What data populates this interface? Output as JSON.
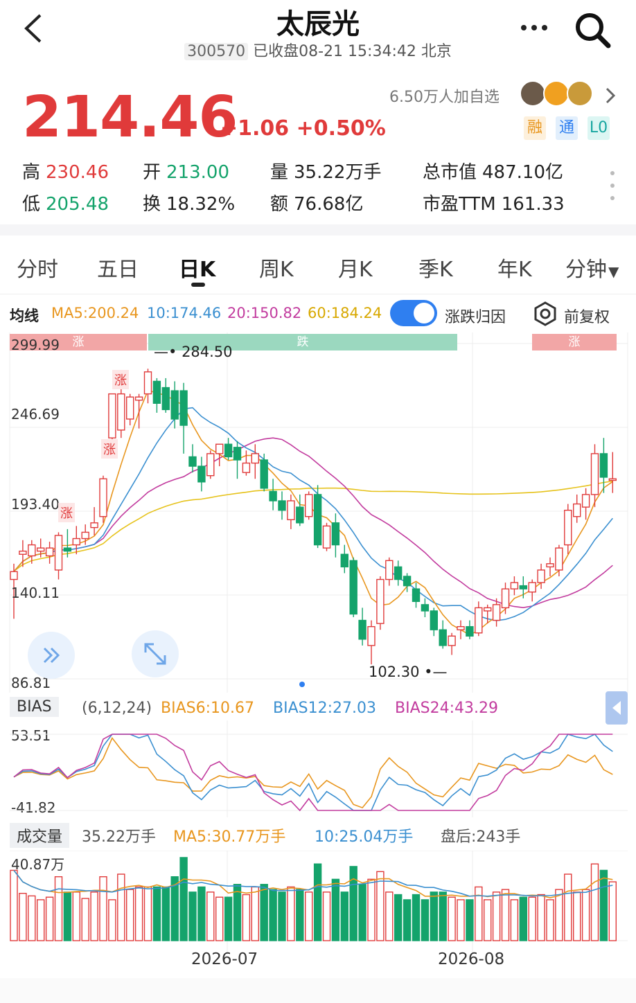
{
  "header": {
    "title": "太辰光",
    "code": "300570",
    "status": "已收盘08-21 15:34:42 北京"
  },
  "quote": {
    "price": "214.46",
    "change": "+1.06 +0.50%",
    "watch_count": "6.50万人加自选",
    "tags": [
      "融",
      "通",
      "L0"
    ]
  },
  "stats": {
    "high_label": "高",
    "high": "230.46",
    "low_label": "低",
    "low": "205.48",
    "open_label": "开",
    "open": "213.00",
    "turnover_label": "换",
    "turnover": "18.32%",
    "volume_label": "量",
    "volume": "35.22万手",
    "amount_label": "额",
    "amount": "76.68亿",
    "mktcap_label": "总市值",
    "mktcap": "487.10亿",
    "pe_label": "市盈TTM",
    "pe": "161.33"
  },
  "period_tabs": [
    "分时",
    "五日",
    "日K",
    "周K",
    "月K",
    "季K",
    "年K",
    "分钟"
  ],
  "active_tab": "日K",
  "ma_legend": {
    "label": "均线",
    "ma5": "MA5:200.24",
    "ma10": "10:174.46",
    "ma20": "20:150.82",
    "ma60": "60:184.24",
    "toggle_label": "涨跌归因",
    "adjust_label": "前复权"
  },
  "colors": {
    "up": "#e03a3a",
    "down": "#14a36b",
    "ma5": "#e8961e",
    "ma10": "#3a8fd0",
    "ma20": "#c23b9e",
    "ma60": "#e6c21a",
    "accent": "#2f7ff0"
  },
  "chart_data": [
    {
      "type": "candlestick",
      "y_ticks": [
        "299.99",
        "246.69",
        "193.40",
        "140.11",
        "86.81"
      ],
      "ylim": [
        86.81,
        299.99
      ],
      "x_ticks": [
        "2026-07",
        "2026-08"
      ],
      "max_label": "284.50",
      "min_label": "102.30",
      "attribution_bands": [
        "涨",
        "跌",
        "涨"
      ],
      "up_markers": [
        "涨",
        "涨",
        "涨"
      ],
      "candles": [
        [
          150,
          160,
          125,
          155
        ],
        [
          166,
          175,
          158,
          168
        ],
        [
          165,
          175,
          160,
          172
        ],
        [
          168,
          176,
          164,
          170
        ],
        [
          165,
          174,
          160,
          170
        ],
        [
          156,
          180,
          150,
          178
        ],
        [
          170,
          182,
          164,
          168
        ],
        [
          172,
          184,
          166,
          176
        ],
        [
          176,
          185,
          172,
          180
        ],
        [
          183,
          196,
          178,
          186
        ],
        [
          190,
          216,
          186,
          214
        ],
        [
          240,
          248,
          236,
          268
        ],
        [
          245,
          272,
          240,
          268
        ],
        [
          252,
          268,
          248,
          266
        ],
        [
          264,
          268,
          246,
          266
        ],
        [
          268,
          284,
          262,
          282
        ],
        [
          276,
          278,
          256,
          262
        ],
        [
          272,
          278,
          256,
          258
        ],
        [
          270,
          276,
          246,
          252
        ],
        [
          270,
          275,
          230,
          248
        ],
        [
          228,
          236,
          218,
          222
        ],
        [
          222,
          228,
          206,
          212
        ],
        [
          216,
          232,
          214,
          230
        ],
        [
          230,
          236,
          222,
          236
        ],
        [
          236,
          240,
          226,
          228
        ],
        [
          234,
          238,
          214,
          226
        ],
        [
          218,
          232,
          216,
          224
        ],
        [
          224,
          236,
          214,
          230
        ],
        [
          226,
          230,
          206,
          208
        ],
        [
          206,
          214,
          194,
          200
        ],
        [
          200,
          206,
          188,
          194
        ],
        [
          188,
          204,
          182,
          200
        ],
        [
          196,
          204,
          184,
          186
        ],
        [
          190,
          206,
          188,
          204
        ],
        [
          204,
          210,
          170,
          172
        ],
        [
          170,
          186,
          168,
          184
        ],
        [
          186,
          192,
          164,
          172
        ],
        [
          166,
          172,
          154,
          158
        ],
        [
          162,
          164,
          126,
          128
        ],
        [
          124,
          132,
          108,
          112
        ],
        [
          108,
          124,
          96,
          120
        ],
        [
          122,
          152,
          118,
          150
        ],
        [
          150,
          164,
          146,
          162
        ],
        [
          158,
          162,
          146,
          150
        ],
        [
          152,
          154,
          142,
          146
        ],
        [
          144,
          148,
          132,
          136
        ],
        [
          134,
          138,
          126,
          130
        ],
        [
          130,
          132,
          114,
          118
        ],
        [
          118,
          124,
          106,
          108
        ],
        [
          108,
          116,
          102,
          114
        ],
        [
          118,
          124,
          112,
          120
        ],
        [
          120,
          124,
          112,
          114
        ],
        [
          116,
          136,
          114,
          132
        ],
        [
          130,
          134,
          122,
          132
        ],
        [
          124,
          138,
          120,
          134
        ],
        [
          132,
          148,
          128,
          144
        ],
        [
          144,
          152,
          140,
          148
        ],
        [
          146,
          152,
          138,
          144
        ],
        [
          142,
          150,
          136,
          148
        ],
        [
          148,
          160,
          144,
          156
        ],
        [
          158,
          164,
          152,
          160
        ],
        [
          156,
          172,
          152,
          170
        ],
        [
          172,
          198,
          166,
          194
        ],
        [
          190,
          204,
          186,
          198
        ],
        [
          196,
          208,
          188,
          204
        ],
        [
          204,
          236,
          196,
          230
        ],
        [
          230,
          240,
          205,
          215
        ],
        [
          213,
          231,
          205,
          214
        ]
      ]
    },
    {
      "type": "line",
      "title": "BIAS",
      "params": "(6,12,24)",
      "series": [
        {
          "name": "BIAS6:10.67"
        },
        {
          "name": "BIAS12:27.03"
        },
        {
          "name": "BIAS24:43.29"
        }
      ],
      "y_ticks": [
        "53.51",
        "-41.82"
      ],
      "ylim": [
        -41.82,
        53.51
      ]
    },
    {
      "type": "bar",
      "title": "成交量",
      "total": "35.22万手",
      "ma5": "MA5:30.77万手",
      "ma10": "10:25.04万手",
      "after_hours": "盘后:243手",
      "y_tick": "40.87万"
    }
  ]
}
